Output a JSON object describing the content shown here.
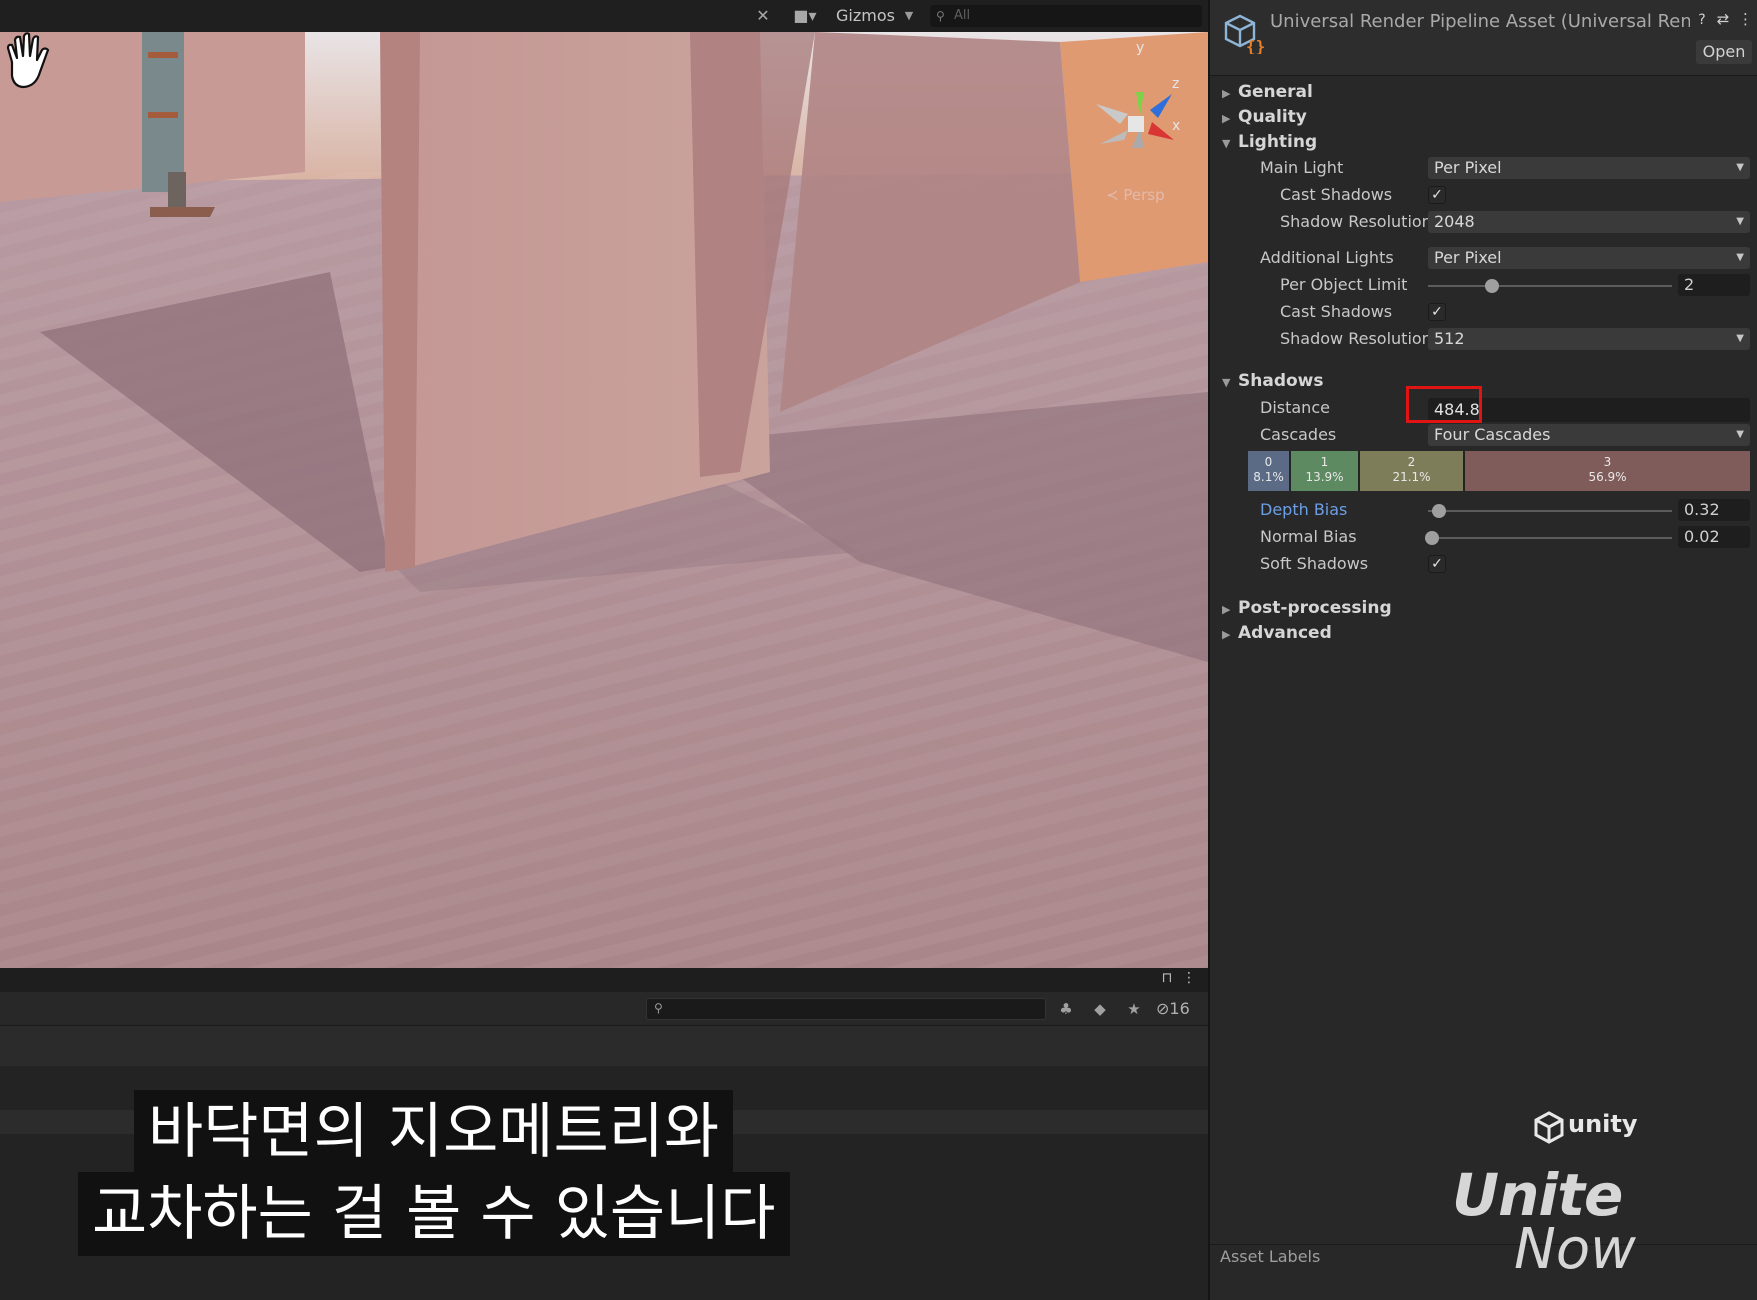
{
  "scene": {
    "toolbar": {
      "gizmos_label": "Gizmos",
      "search_placeholder": "All"
    },
    "orientation_gizmo": {
      "axis_y": "y",
      "axis_z": "z",
      "axis_x": "x",
      "persp_label": "Persp"
    }
  },
  "project_panel": {
    "hidden_count": "16"
  },
  "subtitles": {
    "line1": "바닥면의 지오메트리와",
    "line2": "교차하는 걸 볼 수 있습니다"
  },
  "inspector": {
    "title": "Universal Render Pipeline Asset (Universal Rende",
    "open_button": "Open",
    "sections": {
      "general": "General",
      "quality": "Quality",
      "lighting": "Lighting",
      "shadows": "Shadows",
      "post_processing": "Post-processing",
      "advanced": "Advanced"
    },
    "lighting": {
      "main_light_label": "Main Light",
      "main_light_value": "Per Pixel",
      "cast_shadows_label": "Cast Shadows",
      "cast_shadows_checked": true,
      "shadow_resolution_label": "Shadow Resolution",
      "shadow_resolution_value": "2048",
      "additional_lights_label": "Additional Lights",
      "additional_lights_value": "Per Pixel",
      "per_object_limit_label": "Per Object Limit",
      "per_object_limit_value": "2",
      "add_cast_shadows_label": "Cast Shadows",
      "add_cast_shadows_checked": true,
      "add_shadow_resolution_label": "Shadow Resolution",
      "add_shadow_resolution_value": "512"
    },
    "shadows": {
      "distance_label": "Distance",
      "distance_value": "484.8",
      "cascades_label": "Cascades",
      "cascades_value": "Four Cascades",
      "cascade_splits": [
        {
          "index": "0",
          "percent": "8.1%",
          "color": "#5b6a85"
        },
        {
          "index": "1",
          "percent": "13.9%",
          "color": "#5e8a62"
        },
        {
          "index": "2",
          "percent": "21.1%",
          "color": "#7e7d5a"
        },
        {
          "index": "3",
          "percent": "56.9%",
          "color": "#7f5c5a"
        }
      ],
      "depth_bias_label": "Depth Bias",
      "depth_bias_value": "0.32",
      "normal_bias_label": "Normal Bias",
      "normal_bias_value": "0.02",
      "soft_shadows_label": "Soft Shadows",
      "soft_shadows_checked": true
    },
    "asset_labels": "Asset Labels",
    "highlight_color": "#e11414"
  },
  "watermark": {
    "unity": "unity",
    "unite": "Unite",
    "now": "Now"
  }
}
